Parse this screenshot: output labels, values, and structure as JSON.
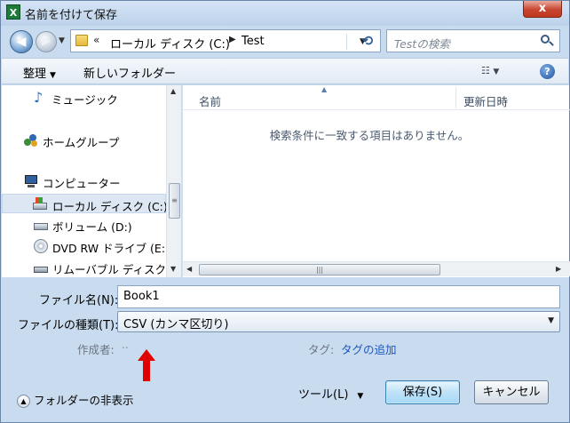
{
  "window": {
    "title": "名前を付けて保存",
    "close_glyph": "x"
  },
  "navbar": {
    "address_chevron": "«",
    "address_segments": [
      "ローカル ディスク (C:)",
      "Test"
    ],
    "address_separator": "▶",
    "search_placeholder": "Testの検索"
  },
  "toolbar": {
    "organize": "整理",
    "new_folder": "新しいフォルダー"
  },
  "navpane": {
    "items": [
      {
        "label": "ミュージック",
        "icon": "music-icon"
      },
      {
        "label": "ホームグループ",
        "icon": "homegroup-icon"
      },
      {
        "label": "コンピューター",
        "icon": "computer-icon"
      },
      {
        "label": "ローカル ディスク (C:)",
        "icon": "drive-icon",
        "selected": true
      },
      {
        "label": "ボリューム (D:)",
        "icon": "drive-icon"
      },
      {
        "label": "DVD RW ドライブ (E:)",
        "icon": "disc-icon"
      },
      {
        "label": "リムーバブル ディスク",
        "icon": "usb-drive-icon"
      }
    ]
  },
  "filelist": {
    "columns": [
      "名前",
      "更新日時"
    ],
    "empty_message": "検索条件に一致する項目はありません。"
  },
  "form": {
    "filename_label": "ファイル名(N):",
    "filename_value": "Book1",
    "filetype_label": "ファイルの種類(T):",
    "filetype_value": "CSV (カンマ区切り)",
    "author_label": "作成者:",
    "author_value": "..",
    "tag_label": "タグ:",
    "tag_link": "タグの追加"
  },
  "footer": {
    "hide_folders": "フォルダーの非表示",
    "tools": "ツール(L)",
    "save": "保存(S)",
    "cancel": "キャンセル"
  },
  "colors": {
    "annotation_arrow": "#e00000",
    "link": "#1a56c2"
  }
}
